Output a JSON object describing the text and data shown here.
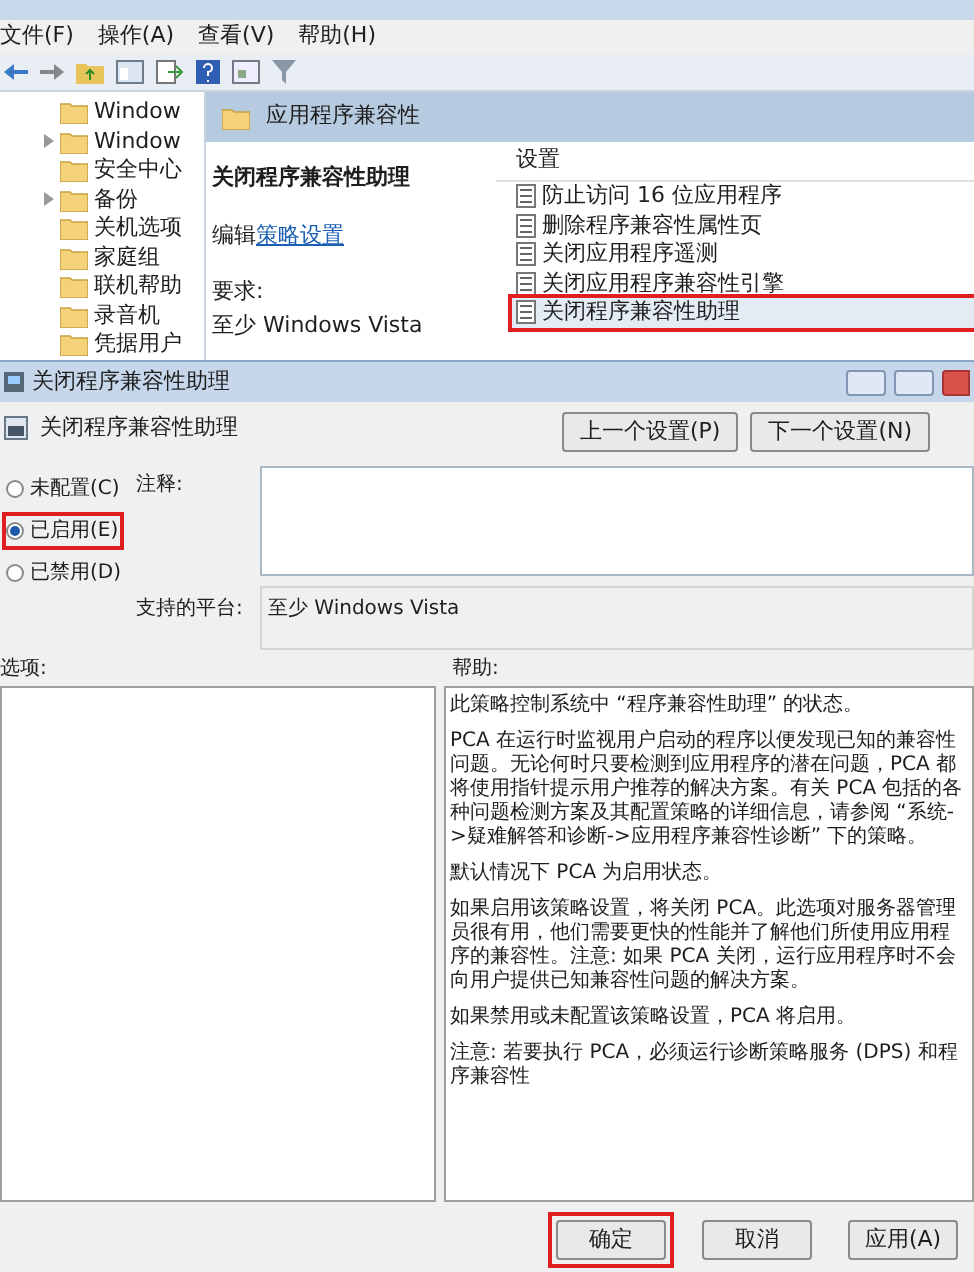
{
  "editor": {
    "menu": [
      "文件(F)",
      "操作(A)",
      "查看(V)",
      "帮助(H)"
    ],
    "tree": [
      {
        "label": "Window",
        "expandable": false
      },
      {
        "label": "Window",
        "expandable": true
      },
      {
        "label": "安全中心",
        "expandable": false
      },
      {
        "label": "备份",
        "expandable": true
      },
      {
        "label": "关机选项",
        "expandable": false
      },
      {
        "label": "家庭组",
        "expandable": false
      },
      {
        "label": "联机帮助",
        "expandable": false
      },
      {
        "label": "录音机",
        "expandable": false
      },
      {
        "label": "凭据用户",
        "expandable": false
      }
    ],
    "folder_header": "应用程序兼容性",
    "description": {
      "title": "关闭程序兼容性助理",
      "edit_prefix": "编辑",
      "edit_link": "策略设置",
      "requirements_label": "要求:",
      "requirements": "至少 Windows Vista"
    },
    "settings_header": "设置",
    "settings": [
      {
        "label": "防止访问 16 位应用程序",
        "selected": false,
        "highlighted": false
      },
      {
        "label": "删除程序兼容性属性页",
        "selected": false,
        "highlighted": false
      },
      {
        "label": "关闭应用程序遥测",
        "selected": false,
        "highlighted": false
      },
      {
        "label": "关闭应用程序兼容性引擎",
        "selected": false,
        "highlighted": false
      },
      {
        "label": "关闭程序兼容性助理",
        "selected": true,
        "highlighted": true
      }
    ]
  },
  "dialog": {
    "title": "关闭程序兼容性助理",
    "heading": "关闭程序兼容性助理",
    "nav_buttons": [
      "上一个设置(P)",
      "下一个设置(N)"
    ],
    "radios": [
      {
        "label": "未配置(C)",
        "selected": false,
        "highlighted": false
      },
      {
        "label": "已启用(E)",
        "selected": true,
        "highlighted": true
      },
      {
        "label": "已禁用(D)",
        "selected": false,
        "highlighted": false
      }
    ],
    "comment_label": "注释:",
    "platform_label": "支持的平台:",
    "platform": "至少 Windows Vista",
    "options_label": "选项:",
    "help_label": "帮助:",
    "help_paragraphs": [
      "此策略控制系统中 “程序兼容性助理” 的状态。",
      "PCA 在运行时监视用户启动的程序以便发现已知的兼容性问题。无论何时只要检测到应用程序的潜在问题，PCA 都将使用指针提示用户推荐的解决方案。有关 PCA 包括的各种问题检测方案及其配置策略的详细信息，请参阅 “系统->疑难解答和诊断->应用程序兼容性诊断” 下的策略。",
      "默认情况下 PCA 为启用状态。",
      "如果启用该策略设置，将关闭 PCA。此选项对服务器管理员很有用，他们需要更快的性能并了解他们所使用应用程序的兼容性。注意: 如果 PCA 关闭，运行应用程序时不会向用户提供已知兼容性问题的解决方案。",
      "如果禁用或未配置该策略设置，PCA 将启用。",
      "注意: 若要执行 PCA，必须运行诊断策略服务 (DPS) 和程序兼容性"
    ],
    "buttons": [
      {
        "label": "确定",
        "highlighted": true
      },
      {
        "label": "取消",
        "highlighted": false
      },
      {
        "label": "应用(A)",
        "highlighted": false
      }
    ]
  }
}
